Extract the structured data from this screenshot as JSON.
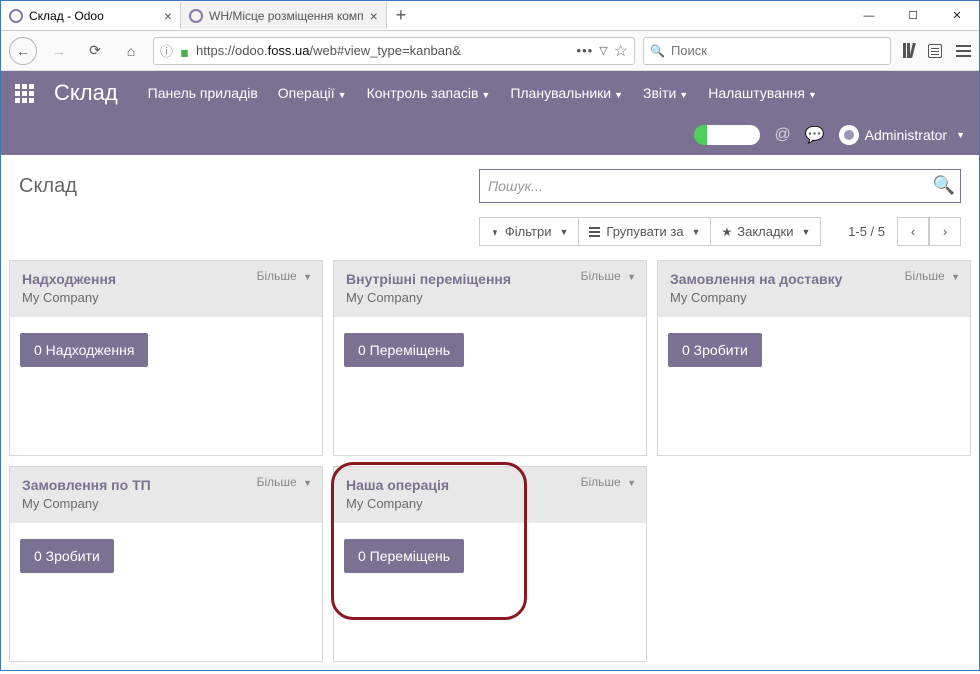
{
  "browser": {
    "tab_active": "Склад - Odoo",
    "tab_inactive": "WH/Місце розміщення комп",
    "url_prefix": "https://odoo.",
    "url_host": "foss.ua",
    "url_path": "/web#view_type=kanban&",
    "search_placeholder": "Поиск"
  },
  "odoo": {
    "app_name": "Склад",
    "menu": {
      "dashboard": "Панель приладів",
      "operations": "Операції",
      "inventory_control": "Контроль запасів",
      "schedulers": "Планувальники",
      "reports": "Звіти",
      "settings": "Налаштування"
    },
    "user": "Administrator"
  },
  "control_panel": {
    "title": "Склад",
    "search_placeholder": "Пошук...",
    "filters_label": "Фільтри",
    "group_label": "Групувати за",
    "bookmarks_label": "Закладки",
    "pager": "1-5 / 5"
  },
  "kanban": {
    "more_label": "Більше",
    "cards": {
      "receipts": {
        "title": "Надходження",
        "subtitle": "My Company",
        "button": "0 Надходження"
      },
      "internal": {
        "title": "Внутрішні переміщення",
        "subtitle": "My Company",
        "button": "0 Переміщень"
      },
      "delivery": {
        "title": "Замовлення на доставку",
        "subtitle": "My Company",
        "button": "0 Зробити"
      },
      "tp_orders": {
        "title": "Замовлення по ТП",
        "subtitle": "My Company",
        "button": "0 Зробити"
      },
      "our_op": {
        "title": "Наша операція",
        "subtitle": "My Company",
        "button": "0 Переміщень"
      }
    }
  }
}
